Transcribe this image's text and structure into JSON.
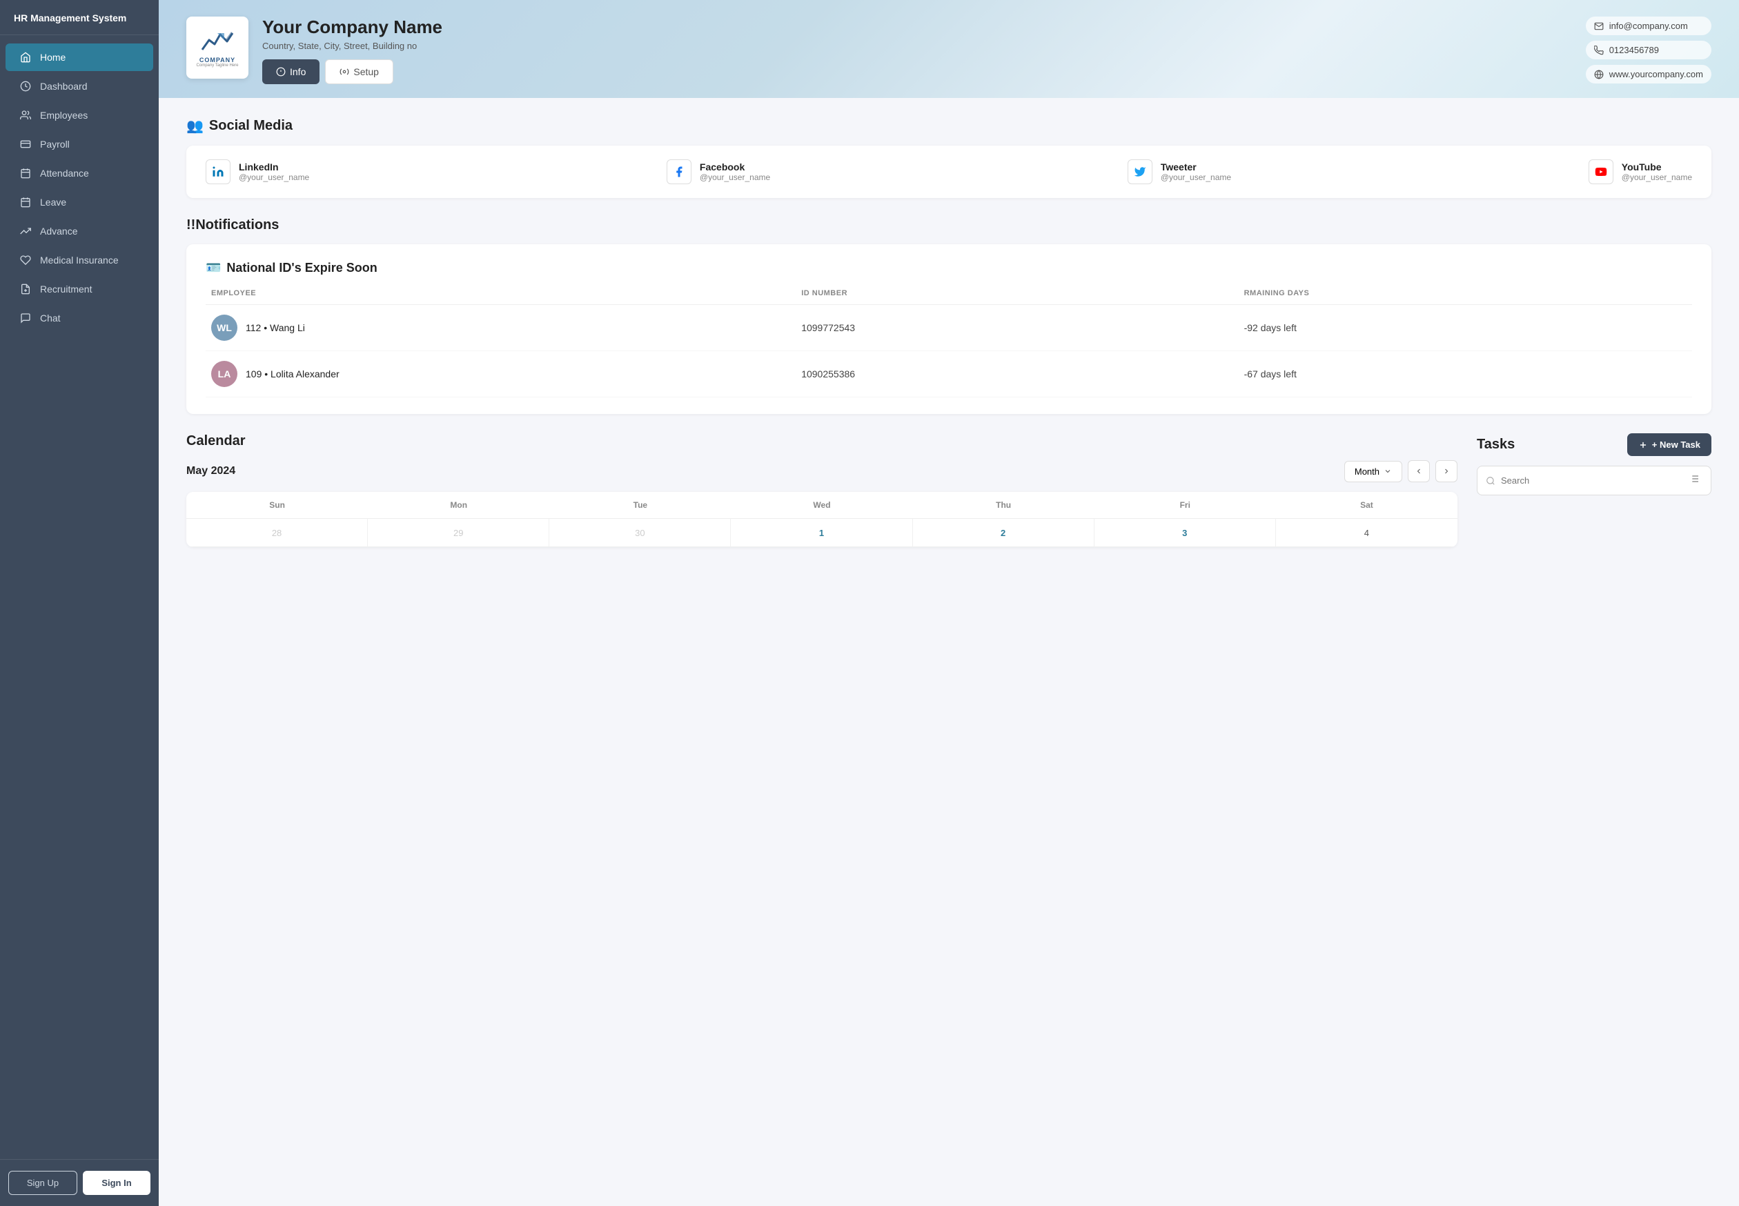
{
  "app": {
    "title": "HR Management System"
  },
  "sidebar": {
    "items": [
      {
        "id": "home",
        "label": "Home",
        "active": true
      },
      {
        "id": "dashboard",
        "label": "Dashboard",
        "active": false
      },
      {
        "id": "employees",
        "label": "Employees",
        "active": false
      },
      {
        "id": "payroll",
        "label": "Payroll",
        "active": false
      },
      {
        "id": "attendance",
        "label": "Attendance",
        "active": false
      },
      {
        "id": "leave",
        "label": "Leave",
        "active": false
      },
      {
        "id": "advance",
        "label": "Advance",
        "active": false
      },
      {
        "id": "medical-insurance",
        "label": "Medical Insurance",
        "active": false
      },
      {
        "id": "recruitment",
        "label": "Recruitment",
        "active": false
      },
      {
        "id": "chat",
        "label": "Chat",
        "active": false
      }
    ],
    "footer": {
      "signup_label": "Sign Up",
      "signin_label": "Sign In"
    }
  },
  "company": {
    "name": "Your Company Name",
    "address": "Country, State, City, Street, Building no",
    "logo_text": "COMPANY",
    "logo_tagline": "Company Tagline Here",
    "email": "info@company.com",
    "phone": "0123456789",
    "website": "www.yourcompany.com",
    "tabs": {
      "info_label": "Info",
      "setup_label": "Setup"
    }
  },
  "social_media": {
    "section_title": "Social Media",
    "platforms": [
      {
        "name": "LinkedIn",
        "handle": "@your_user_name"
      },
      {
        "name": "Facebook",
        "handle": "@your_user_name"
      },
      {
        "name": "Tweeter",
        "handle": "@your_user_name"
      },
      {
        "name": "YouTube",
        "handle": "@your_user_name"
      }
    ]
  },
  "notifications": {
    "section_title": "!!Notifications",
    "national_id": {
      "title": "National ID's Expire Soon",
      "columns": [
        "EMPLOYEE",
        "ID NUMBER",
        "RMAINING DAYS"
      ],
      "rows": [
        {
          "id": "112",
          "name": "Wang Li",
          "id_number": "1099772543",
          "days": "-92 days left",
          "avatar_bg": "#8899aa"
        },
        {
          "id": "109",
          "name": "Lolita Alexander",
          "id_number": "1090255386",
          "days": "-67 days left",
          "avatar_bg": "#aa8899"
        }
      ]
    }
  },
  "calendar": {
    "title": "Calendar",
    "month_year": "May 2024",
    "view_label": "Month",
    "day_headers": [
      "Sun",
      "Mon",
      "Tue",
      "Wed",
      "Thu",
      "Fri",
      "Sat"
    ],
    "weeks": [
      [
        {
          "day": "28",
          "other": true
        },
        {
          "day": "29",
          "other": true
        },
        {
          "day": "30",
          "other": true
        },
        {
          "day": "1",
          "highlight": true
        },
        {
          "day": "2",
          "highlight": true
        },
        {
          "day": "3",
          "highlight": true
        },
        {
          "day": "4",
          "highlight": false
        }
      ]
    ]
  },
  "tasks": {
    "title": "Tasks",
    "new_task_label": "+ New Task",
    "search_placeholder": "Search"
  }
}
